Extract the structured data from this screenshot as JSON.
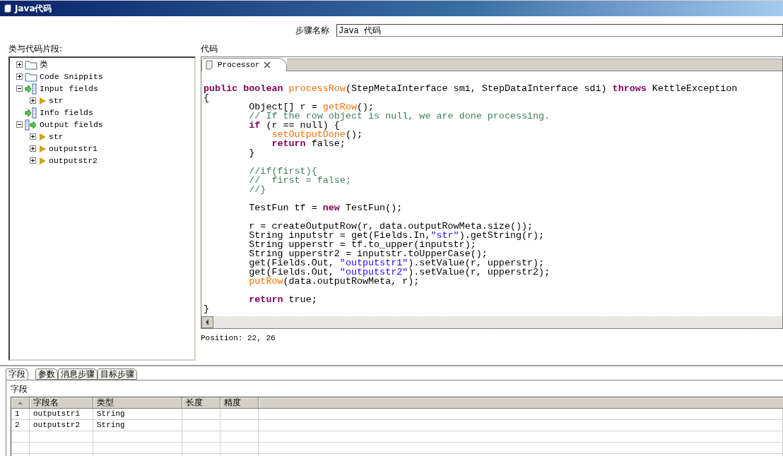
{
  "window": {
    "title": "Java代码"
  },
  "step_name": {
    "label": "步骤名称",
    "value": "Java 代码"
  },
  "snippets": {
    "label": "类与代码片段:",
    "items": [
      {
        "kind": "folder",
        "label": "类",
        "expanded": false
      },
      {
        "kind": "folder",
        "label": "Code Snippits",
        "expanded": false
      },
      {
        "kind": "input",
        "label": "Input fields",
        "expanded": true,
        "children": [
          {
            "kind": "field",
            "label": "str",
            "expanded": false
          }
        ]
      },
      {
        "kind": "info",
        "label": "Info fields"
      },
      {
        "kind": "output",
        "label": "Output fields",
        "expanded": true,
        "children": [
          {
            "kind": "field",
            "label": "str",
            "expanded": false
          },
          {
            "kind": "field",
            "label": "outputstr1",
            "expanded": false
          },
          {
            "kind": "field",
            "label": "outputstr2",
            "expanded": false
          }
        ]
      }
    ]
  },
  "code": {
    "label": "代码",
    "tab": {
      "label": "Processor",
      "selected": true
    },
    "position": "Position: 22, 26",
    "lines": [
      {
        "kind": "code",
        "tokens": [
          {
            "kind": "kw",
            "text": "public"
          },
          {
            "kind": "kw",
            "text": " boolean"
          },
          {
            "kind": "fn",
            "text": " processRow"
          },
          {
            "kind": "plain",
            "text": "(StepMetaInterface smi, StepDataInterface sdi) "
          },
          {
            "kind": "kw",
            "text": "throws"
          },
          {
            "kind": "plain",
            "text": " KettleException"
          }
        ]
      },
      {
        "kind": "code",
        "tokens": [
          {
            "kind": "plain",
            "text": "{"
          }
        ]
      },
      {
        "kind": "code",
        "tokens": [
          {
            "kind": "plain",
            "text": "        Object[] r = "
          },
          {
            "kind": "fn",
            "text": "getRow"
          },
          {
            "kind": "plain",
            "text": "();"
          }
        ]
      },
      {
        "kind": "code",
        "tokens": [
          {
            "kind": "cm",
            "text": "        // If the row object is null, we are done processing."
          }
        ]
      },
      {
        "kind": "code",
        "tokens": [
          {
            "kind": "kw",
            "text": "        if"
          },
          {
            "kind": "plain",
            "text": " (r == null) {"
          }
        ]
      },
      {
        "kind": "code",
        "tokens": [
          {
            "kind": "fn",
            "text": "            setOutputDone"
          },
          {
            "kind": "plain",
            "text": "();"
          }
        ]
      },
      {
        "kind": "code",
        "tokens": [
          {
            "kind": "kw",
            "text": "            return"
          },
          {
            "kind": "plain",
            "text": " false;"
          }
        ]
      },
      {
        "kind": "code",
        "tokens": [
          {
            "kind": "plain",
            "text": "        }"
          }
        ]
      },
      {
        "kind": "blank"
      },
      {
        "kind": "code",
        "tokens": [
          {
            "kind": "cm",
            "text": "        //if(first){"
          }
        ]
      },
      {
        "kind": "code",
        "tokens": [
          {
            "kind": "cm",
            "text": "        //  first = false;"
          }
        ]
      },
      {
        "kind": "code",
        "tokens": [
          {
            "kind": "cm",
            "text": "        //}"
          }
        ]
      },
      {
        "kind": "blank"
      },
      {
        "kind": "code",
        "tokens": [
          {
            "kind": "plain",
            "text": "        TestFun tf = "
          },
          {
            "kind": "kw",
            "text": "new"
          },
          {
            "kind": "plain",
            "text": " TestFun();"
          }
        ]
      },
      {
        "kind": "blank"
      },
      {
        "kind": "code",
        "tokens": [
          {
            "kind": "plain",
            "text": "        r = createOutputRow(r, data.outputRowMeta.size());"
          }
        ]
      },
      {
        "kind": "code",
        "tokens": [
          {
            "kind": "plain",
            "text": "        String inputstr = get(Fields.In,"
          },
          {
            "kind": "str",
            "text": "\"str\""
          },
          {
            "kind": "plain",
            "text": ").getString(r);"
          }
        ]
      },
      {
        "kind": "code",
        "tokens": [
          {
            "kind": "plain",
            "text": "        String upperstr = tf.to_upper(inputstr);"
          }
        ]
      },
      {
        "kind": "code",
        "tokens": [
          {
            "kind": "plain",
            "text": "        String upperstr2 = inputstr.toUpperCase();"
          }
        ]
      },
      {
        "kind": "code",
        "tokens": [
          {
            "kind": "plain",
            "text": "        get(Fields.Out, "
          },
          {
            "kind": "str",
            "text": "\"outputstr1\""
          },
          {
            "kind": "plain",
            "text": ").setValue(r, upperstr);"
          }
        ]
      },
      {
        "kind": "code",
        "tokens": [
          {
            "kind": "plain",
            "text": "        get(Fields.Out, "
          },
          {
            "kind": "str",
            "text": "\"outputstr2\""
          },
          {
            "kind": "plain",
            "text": ").setValue(r, upperstr2);"
          }
        ]
      },
      {
        "kind": "code",
        "tokens": [
          {
            "kind": "fn",
            "text": "        putRow"
          },
          {
            "kind": "plain",
            "text": "(data.outputRowMeta, r);"
          }
        ]
      },
      {
        "kind": "blank"
      },
      {
        "kind": "code",
        "tokens": [
          {
            "kind": "kw",
            "text": "        return"
          },
          {
            "kind": "plain",
            "text": " true;"
          }
        ]
      },
      {
        "kind": "code",
        "tokens": [
          {
            "kind": "plain",
            "text": "}"
          }
        ]
      }
    ]
  },
  "bottom_tabs": [
    {
      "label": "字段",
      "selected": true
    },
    {
      "label": "参数",
      "selected": false
    },
    {
      "label": "消息步骤",
      "selected": false
    },
    {
      "label": "目标步骤",
      "selected": false
    }
  ],
  "fields": {
    "label": "字段",
    "columns": [
      "字段名",
      "类型",
      "长度",
      "精度"
    ],
    "rows": [
      {
        "index": "1",
        "name": "outputstr1",
        "type": "String"
      },
      {
        "index": "2",
        "name": "outputstr2",
        "type": "String"
      }
    ]
  }
}
